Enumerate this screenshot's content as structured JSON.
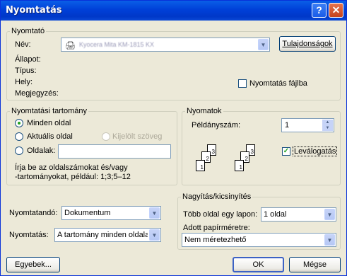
{
  "title": "Nyomtatás",
  "printer": {
    "legend": "Nyomtató",
    "name_label": "Név:",
    "name_value": "Kyocera Mita KM-1815 KX",
    "properties_button": "Tulajdonságok",
    "status_label": "Állapot:",
    "type_label": "Típus:",
    "where_label": "Hely:",
    "comment_label": "Megjegyzés:",
    "print_to_file_label": "Nyomtatás fájlba",
    "print_to_file_checked": false
  },
  "range": {
    "legend": "Nyomtatási tartomány",
    "all_label": "Minden oldal",
    "current_label": "Aktuális oldal",
    "selection_label": "Kijelölt szöveg",
    "pages_label": "Oldalak:",
    "pages_value": "",
    "hint_line1": "Írja be az oldalszámokat és/vagy",
    "hint_line2": "-tartományokat, például: 1;3;5–12",
    "selected": "all"
  },
  "copies": {
    "legend": "Nyomatok",
    "count_label": "Példányszám:",
    "count_value": "1",
    "collate_label": "Leválogatás",
    "collate_checked": true,
    "stack1": [
      "1",
      "2",
      "3"
    ],
    "stack2": [
      "1",
      "2",
      "3"
    ]
  },
  "print_what": {
    "label": "Nyomtatandó:",
    "value": "Dokumentum"
  },
  "print_range_select": {
    "label": "Nyomtatás:",
    "value": "A tartomány minden oldala"
  },
  "zoom": {
    "legend": "Nagyítás/kicsinyítés",
    "pages_per_sheet_label": "Több oldal egy lapon:",
    "pages_per_sheet_value": "1 oldal",
    "scale_label": "Adott papírméretre:",
    "scale_value": "Nem méretezhető"
  },
  "buttons": {
    "options": "Egyebek...",
    "ok": "OK",
    "cancel": "Mégse"
  },
  "titlebar_buttons": {
    "help": "?",
    "close": "✕"
  },
  "colors": {
    "titlebar": "#0040d8",
    "dialog_bg": "#ece9d8",
    "check_green": "#21a121"
  }
}
